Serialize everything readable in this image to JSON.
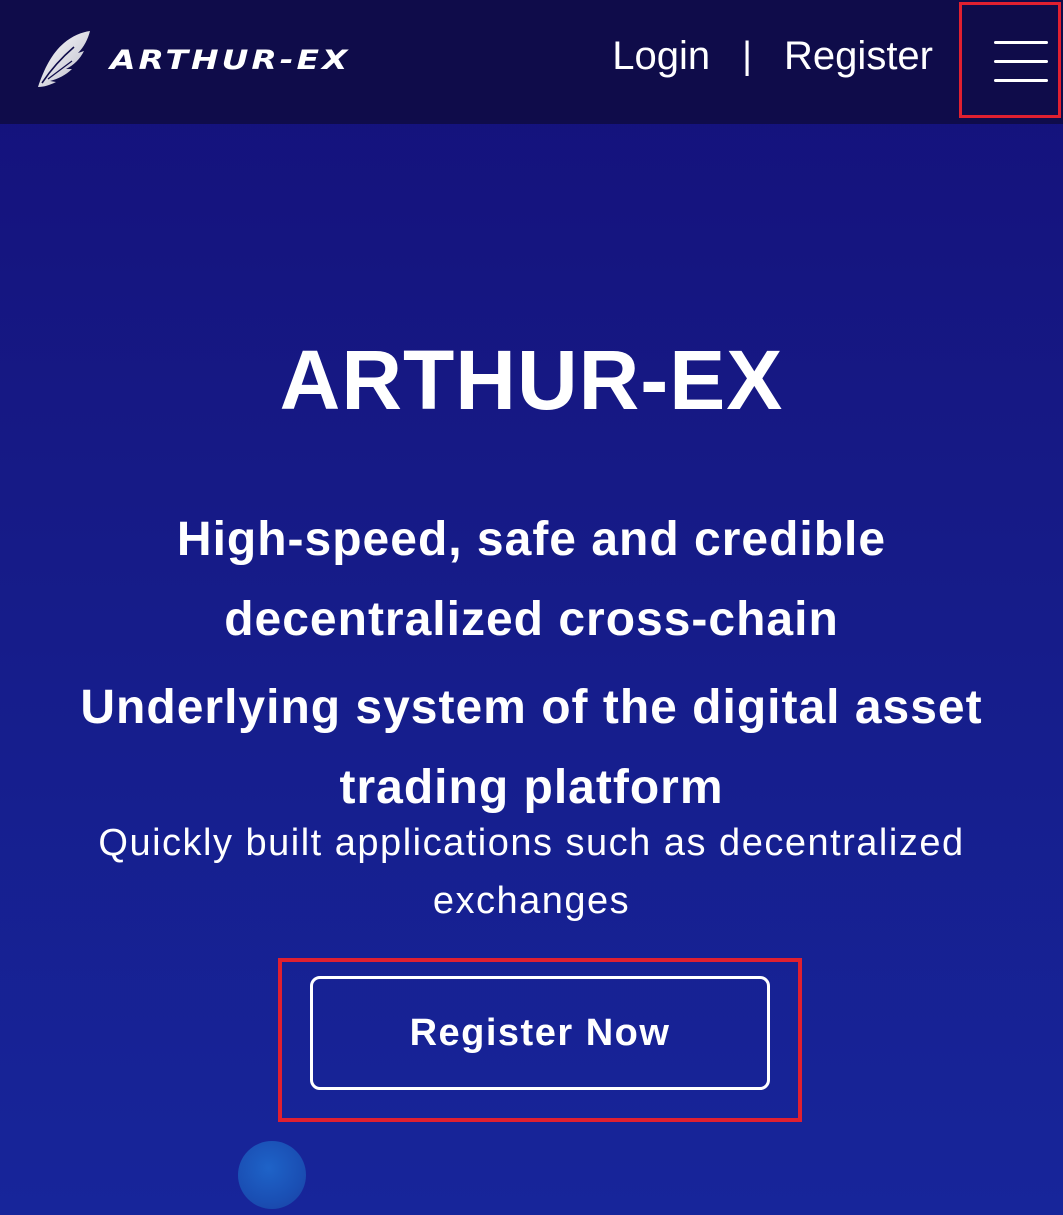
{
  "header": {
    "brand": "ARTHUR-EX",
    "logo_icon": "feather-wing-icon",
    "nav": {
      "login_label": "Login",
      "separator": "|",
      "register_label": "Register"
    },
    "menu_icon": "hamburger-menu-icon"
  },
  "hero": {
    "title": "ARTHUR-EX",
    "subtitle_1": "High-speed, safe and credible decentralized cross-chain",
    "subtitle_2": "Underlying system of the digital asset trading platform",
    "description": "Quickly built applications such as decentralized exchanges",
    "cta_label": "Register Now"
  },
  "colors": {
    "header_bg": "#0f0c4a",
    "hero_bg_top": "#14107a",
    "hero_bg_bottom": "#17259a",
    "highlight_border": "#e02030",
    "text": "#ffffff"
  }
}
